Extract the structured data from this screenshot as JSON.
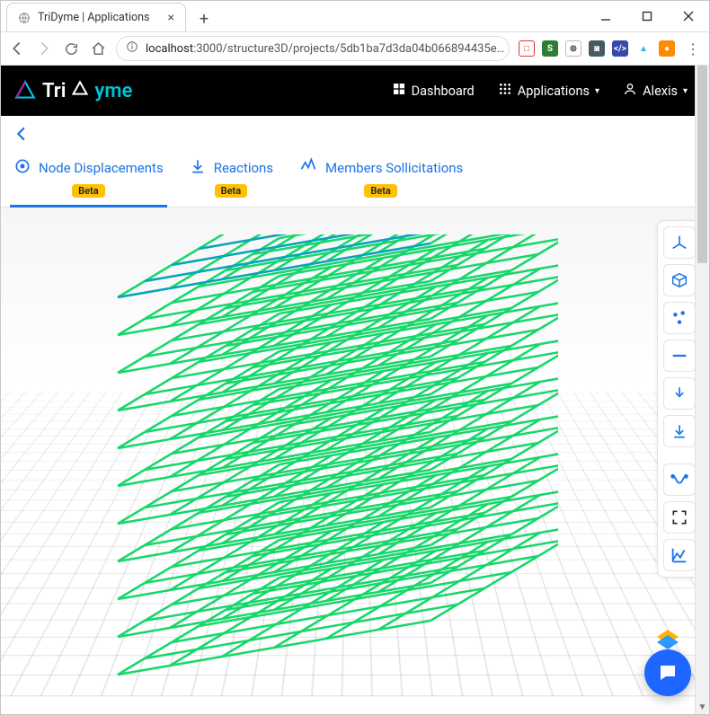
{
  "browser": {
    "tab_title": "TriDyme | Applications",
    "url_host": "localhost",
    "url_port": ":3000",
    "url_path": "/structure3D/projects/5db1ba7d3da04b066894435e…",
    "ext_badges": [
      "□",
      "S",
      "⊗",
      "◙",
      "</>",
      "▲",
      "●"
    ]
  },
  "header": {
    "brand_a": "Tri",
    "brand_b": "yme",
    "nav": {
      "dashboard": "Dashboard",
      "applications": "Applications",
      "user": "Alexis"
    }
  },
  "tabs": {
    "items": [
      {
        "label": "Node Displacements",
        "badge": "Beta",
        "active": true
      },
      {
        "label": "Reactions",
        "badge": "Beta",
        "active": false
      },
      {
        "label": "Members Sollicitations",
        "badge": "Beta",
        "active": false
      }
    ]
  },
  "tools": {
    "names": [
      "axes",
      "box-view",
      "nodes",
      "line",
      "download",
      "import",
      "deflection",
      "fullscreen",
      "results-chart"
    ]
  }
}
